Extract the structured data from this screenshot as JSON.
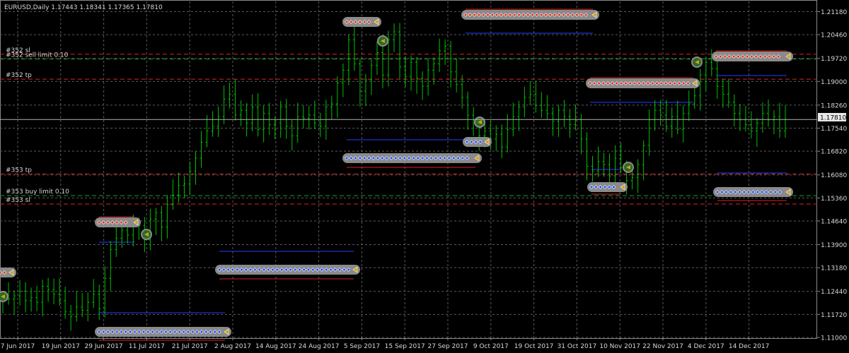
{
  "window": {
    "symbol_line": "EURUSD,Daily  1.17443 1.18341 1.17365 1.17810"
  },
  "price_axis": {
    "labels": [
      "1.21180",
      "1.20460",
      "1.19720",
      "1.19000",
      "1.18260",
      "1.17540",
      "1.16820",
      "1.16080",
      "1.15360",
      "1.14640",
      "1.13900",
      "1.13180",
      "1.12440",
      "1.11720",
      "1.11000"
    ],
    "current_price": "1.17810"
  },
  "time_axis": {
    "labels": [
      "7 Jun 2017",
      "19 Jun 2017",
      "29 Jun 2017",
      "11 Jul 2017",
      "21 Jul 2017",
      "2 Aug 2017",
      "14 Aug 2017",
      "24 Aug 2017",
      "5 Sep 2017",
      "15 Sep 2017",
      "27 Sep 2017",
      "9 Oct 2017",
      "19 Oct 2017",
      "31 Oct 2017",
      "10 Nov 2017",
      "22 Nov 2017",
      "4 Dec 2017",
      "14 Dec 2017"
    ]
  },
  "order_lines": [
    {
      "label": "#352 sl",
      "price": 1.1985,
      "color": "#e02020",
      "style": "dashed"
    },
    {
      "label": "#352 sell limit 0.10",
      "price": 1.197,
      "color": "#20a020",
      "style": "dashed"
    },
    {
      "label": "#352 tp",
      "price": 1.1907,
      "color": "#e02020",
      "style": "dashed"
    },
    {
      "label": "#353 tp",
      "price": 1.1611,
      "color": "#e02020",
      "style": "dashed"
    },
    {
      "label": "#353 buy limit 0.10",
      "price": 1.1543,
      "color": "#20a020",
      "style": "dashed"
    },
    {
      "label": "#353 sl",
      "price": 1.1517,
      "color": "#e02020",
      "style": "dashed"
    }
  ],
  "colors": {
    "background": "#000000",
    "grid": "#5a5a5a",
    "candle": "#00c000",
    "bid_line": "#b0b0b0",
    "sell_marker": "#e03020",
    "buy_marker": "#2050ff",
    "marker_pill": "#8a8a8a",
    "close_marker": "#d8a000",
    "close_win": "#20c020"
  },
  "chart_data": {
    "type": "candlestick",
    "symbol": "EURUSD",
    "timeframe": "Daily",
    "title": "EURUSD,Daily  1.17443 1.18341 1.17365 1.17810",
    "ylim": [
      1.11,
      1.215
    ],
    "ohlc_last": {
      "open": 1.17443,
      "high": 1.18341,
      "low": 1.17365,
      "close": 1.1781
    },
    "close_series": [
      1.1225,
      1.122,
      1.123,
      1.1245,
      1.1215,
      1.1225,
      1.121,
      1.126,
      1.125,
      1.1235,
      1.1215,
      1.118,
      1.1165,
      1.1195,
      1.1185,
      1.121,
      1.1235,
      1.119,
      1.1285,
      1.1375,
      1.141,
      1.1435,
      1.142,
      1.1455,
      1.145,
      1.1405,
      1.147,
      1.149,
      1.1445,
      1.1515,
      1.1545,
      1.1575,
      1.158,
      1.162,
      1.166,
      1.171,
      1.1745,
      1.176,
      1.179,
      1.1845,
      1.186,
      1.1795,
      1.181,
      1.177,
      1.182,
      1.175,
      1.18,
      1.1765,
      1.177,
      1.182,
      1.176,
      1.173,
      1.179,
      1.1785,
      1.1795,
      1.177,
      1.176,
      1.182,
      1.183,
      1.1895,
      1.1935,
      1.203,
      1.1955,
      1.187,
      1.1905,
      1.195,
      1.199,
      1.192,
      1.203,
      1.2055,
      1.1945,
      1.1915,
      1.196,
      1.191,
      1.1885,
      1.1935,
      1.1955,
      1.1995,
      1.201,
      1.193,
      1.189,
      1.185,
      1.1795,
      1.177,
      1.173,
      1.1745,
      1.172,
      1.1735,
      1.1695,
      1.175,
      1.179,
      1.182,
      1.185,
      1.186,
      1.1825,
      1.181,
      1.18,
      1.1775,
      1.181,
      1.179,
      1.1765,
      1.178,
      1.172,
      1.1635,
      1.162,
      1.165,
      1.164,
      1.1605,
      1.166,
      1.163,
      1.159,
      1.16,
      1.164,
      1.17,
      1.178,
      1.181,
      1.1795,
      1.176,
      1.179,
      1.175,
      1.18,
      1.183,
      1.1855,
      1.192,
      1.196,
      1.194,
      1.1885,
      1.186,
      1.1835,
      1.18,
      1.178,
      1.1765,
      1.1745,
      1.177,
      1.18,
      1.178,
      1.179,
      1.1745,
      1.1781
    ]
  }
}
